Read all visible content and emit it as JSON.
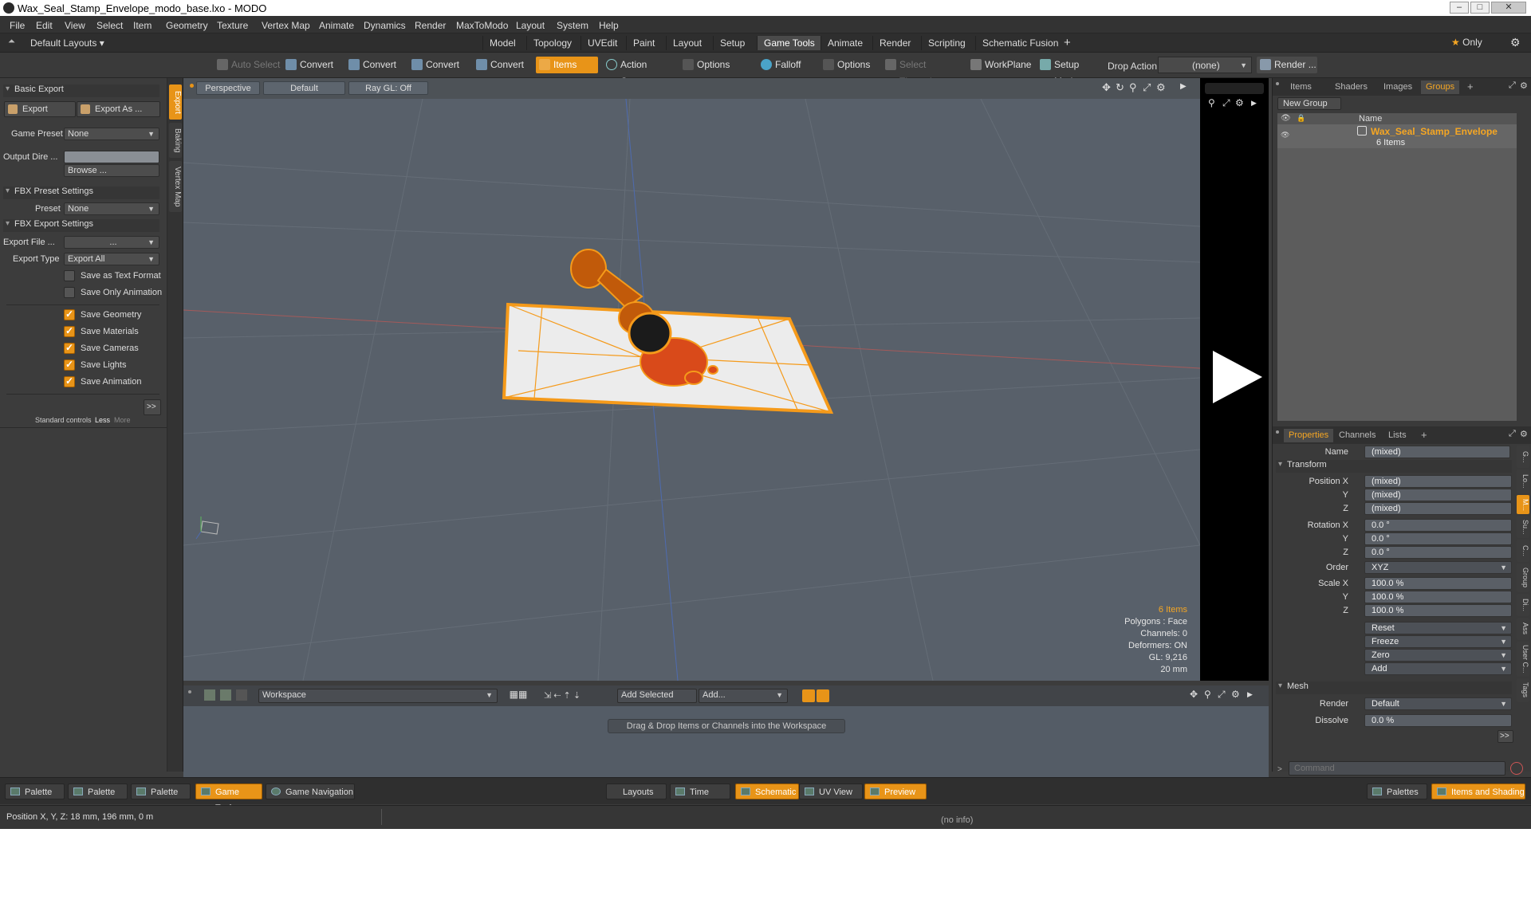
{
  "window": {
    "title": "Wax_Seal_Stamp_Envelope_modo_base.lxo - MODO"
  },
  "menu": [
    "File",
    "Edit",
    "View",
    "Select",
    "Item",
    "Geometry",
    "Texture",
    "Vertex Map",
    "Animate",
    "Dynamics",
    "Render",
    "MaxToModo",
    "Layout",
    "System",
    "Help"
  ],
  "layouts": {
    "default_label": "Default Layouts",
    "tabs": [
      "Model",
      "Topology",
      "UVEdit",
      "Paint",
      "Layout",
      "Setup",
      "Game Tools",
      "Animate",
      "Render",
      "Scripting",
      "Schematic Fusion"
    ],
    "active": "Game Tools",
    "only_label": "Only"
  },
  "toolbar": {
    "auto_select": "Auto Select",
    "convert1": "Convert",
    "convert2": "Convert",
    "convert3": "Convert",
    "convert4": "Convert",
    "items": "Items",
    "action_center": "Action Center",
    "options1": "Options",
    "falloff": "Falloff",
    "options2": "Options",
    "select_through": "Select Through",
    "workplane": "WorkPlane",
    "setup_mode": "Setup Mode",
    "drop_action_label": "Drop Action",
    "drop_action_value": "(none)",
    "render": "Render ..."
  },
  "left": {
    "vtabs": [
      "Export",
      "Baking",
      "Vertex Map"
    ],
    "basic_export": "Basic Export",
    "export_btn": "Export",
    "export_as_btn": "Export As ...",
    "game_preset_label": "Game Preset",
    "game_preset_value": "None",
    "output_dir_label": "Output Dire ...",
    "browse": "Browse ...",
    "fbx_preset": "FBX Preset Settings",
    "preset_label": "Preset",
    "preset_value": "None",
    "fbx_export": "FBX Export Settings",
    "export_file_label": "Export File ...",
    "export_file_value": "...",
    "export_type_label": "Export Type",
    "export_type_value": "Export All",
    "checks": [
      {
        "label": "Save as Text Format",
        "checked": false
      },
      {
        "label": "Save Only Animation",
        "checked": false
      },
      {
        "label": "Save Geometry",
        "checked": true
      },
      {
        "label": "Save Materials",
        "checked": true
      },
      {
        "label": "Save Cameras",
        "checked": true
      },
      {
        "label": "Save Lights",
        "checked": true
      },
      {
        "label": "Save Animation",
        "checked": true
      }
    ],
    "more_arrow": ">>",
    "standard_controls": "Standard controls",
    "less": "Less",
    "more": "More"
  },
  "viewport": {
    "perspective": "Perspective",
    "default": "Default",
    "raygl": "Ray GL: Off",
    "info": {
      "items": "6 Items",
      "polygons": "Polygons : Face",
      "channels": "Channels: 0",
      "deformers": "Deformers: ON",
      "gl": "GL: 9,216",
      "scale": "20 mm"
    }
  },
  "workspace": {
    "dropdown": "Workspace",
    "add_selected": "Add Selected",
    "add": "Add...",
    "hint": "Drag & Drop Items or Channels into the Workspace"
  },
  "groups": {
    "tabs": [
      "Items",
      "Shaders",
      "Images",
      "Groups"
    ],
    "active": "Groups",
    "new_group": "New Group",
    "name_col": "Name",
    "group_name": "Wax_Seal_Stamp_Envelope",
    "group_count": "6 Items"
  },
  "properties": {
    "tabs": [
      "Properties",
      "Channels",
      "Lists"
    ],
    "active": "Properties",
    "name_label": "Name",
    "name_value": "(mixed)",
    "transform": "Transform",
    "position_x_label": "Position X",
    "y_label": "Y",
    "z_label": "Z",
    "pos_x": "(mixed)",
    "pos_y": "(mixed)",
    "pos_z": "(mixed)",
    "rotation_x_label": "Rotation X",
    "rot_x": "0.0 °",
    "rot_y": "0.0 °",
    "rot_z": "0.0 °",
    "order_label": "Order",
    "order_value": "XYZ",
    "scale_x_label": "Scale X",
    "scl_x": "100.0 %",
    "scl_y": "100.0 %",
    "scl_z": "100.0 %",
    "reset": "Reset",
    "freeze": "Freeze",
    "zero": "Zero",
    "add": "Add",
    "mesh": "Mesh",
    "render_label": "Render",
    "render_value": "Default",
    "dissolve_label": "Dissolve",
    "dissolve_value": "0.0 %",
    "side_tabs": [
      "G...",
      "Lo...",
      "M...",
      "Su...",
      "C...",
      "Group",
      "Di...",
      "Ass",
      "User C...",
      "Tags"
    ],
    "command_placeholder": "Command"
  },
  "bottom": {
    "palette1": "Palette",
    "palette2": "Palette",
    "palette3": "Palette",
    "game_tools": "Game Tools",
    "game_navigation": "Game Navigation",
    "layouts": "Layouts",
    "time": "Time",
    "schematic": "Schematic",
    "uv_view": "UV View",
    "preview": "Preview",
    "palettes": "Palettes",
    "items_shading": "Items and Shading"
  },
  "status": {
    "position": "Position X, Y, Z:   18 mm, 196 mm, 0 m",
    "info": "(no info)"
  },
  "colors": {
    "accent": "#e89418",
    "viewport": "#58606a",
    "selection": "#f59a1a"
  }
}
